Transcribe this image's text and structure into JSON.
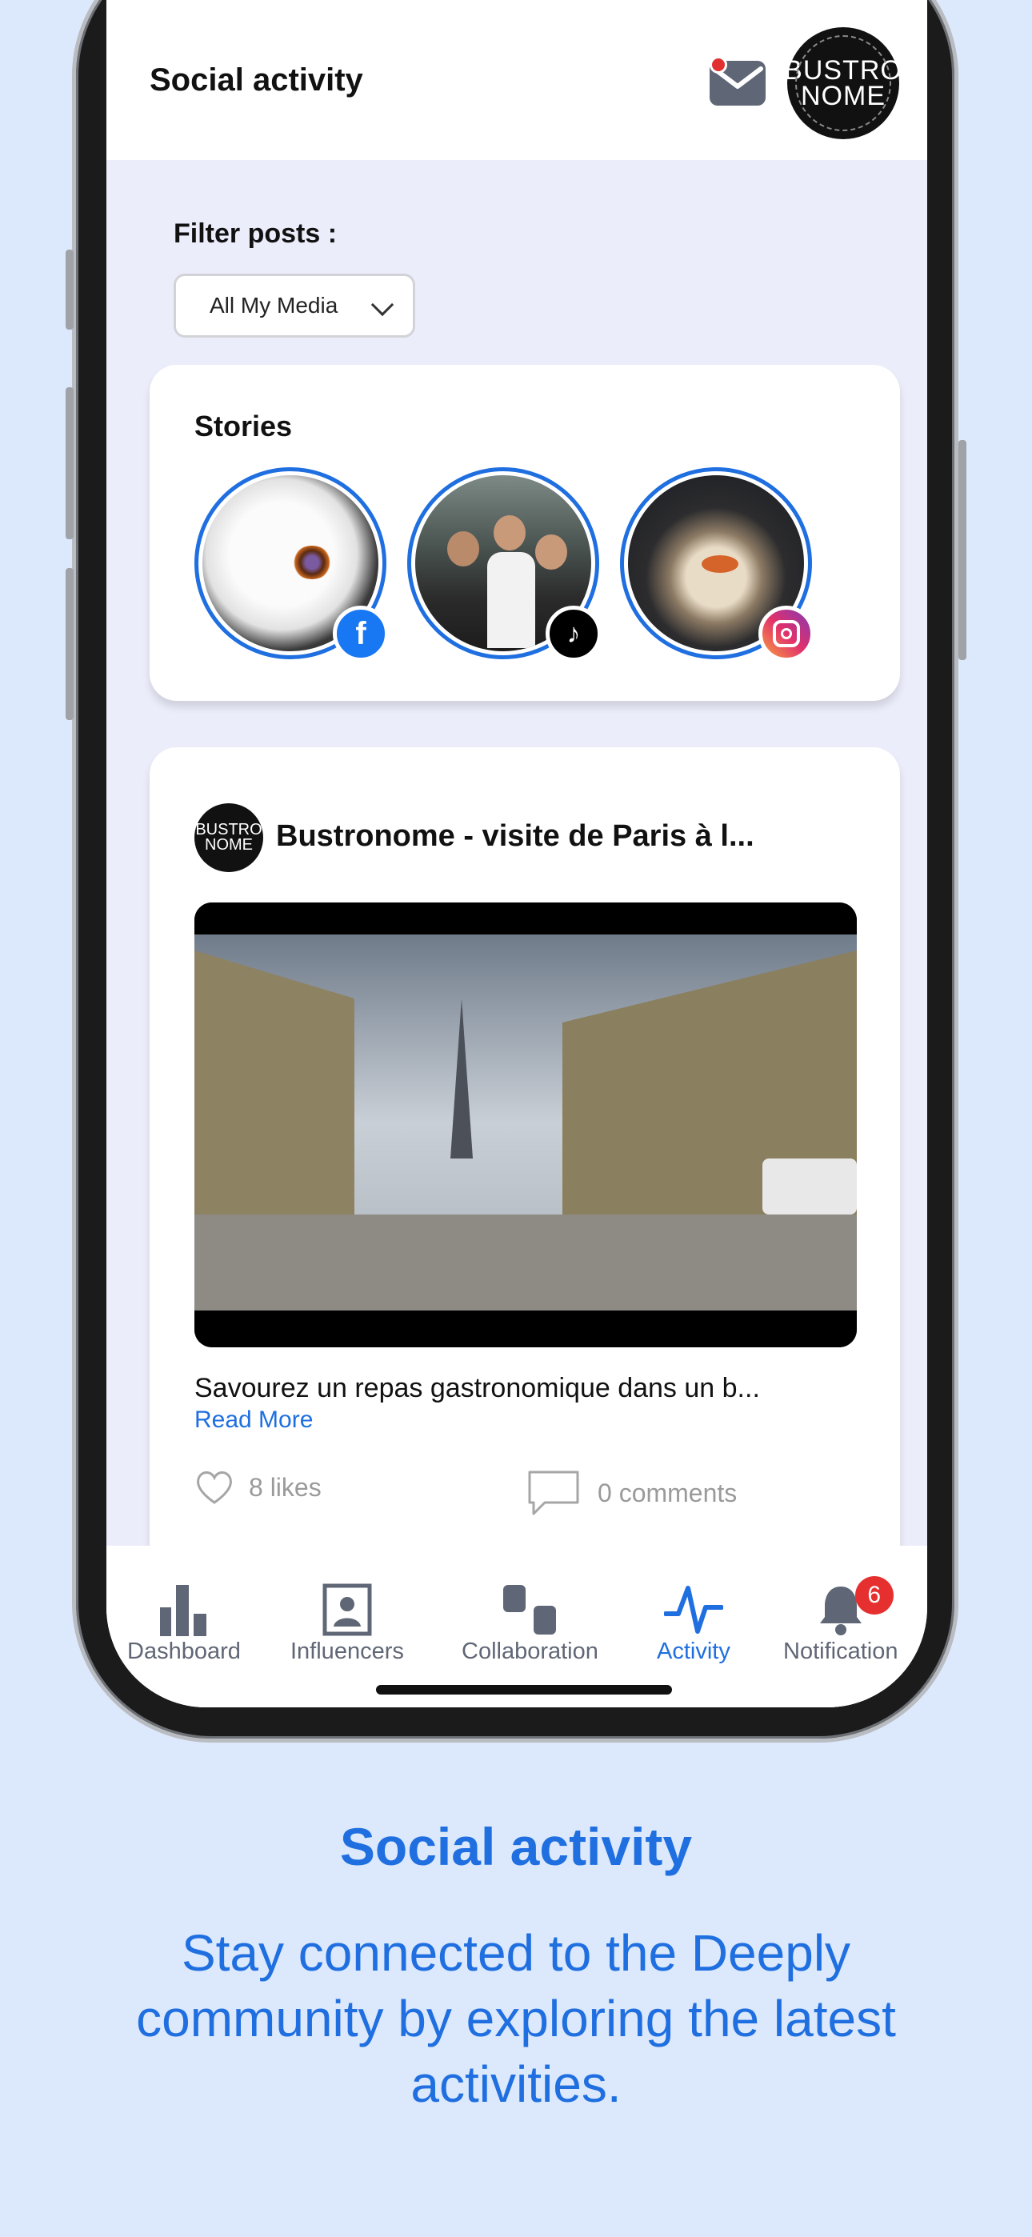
{
  "header": {
    "title": "Social activity",
    "has_unread_mail": true
  },
  "brand": {
    "line1": "BUSTRO",
    "line2": "NOME"
  },
  "filter": {
    "label": "Filter posts :",
    "selected": "All My Media"
  },
  "stories": {
    "title": "Stories",
    "items": [
      {
        "platform": "facebook",
        "badge_icon": "facebook-icon",
        "badge_color": "#1877f2"
      },
      {
        "platform": "tiktok",
        "badge_icon": "tiktok-icon",
        "badge_color": "#000000"
      },
      {
        "platform": "instagram",
        "badge_icon": "instagram-icon",
        "badge_color": "#e1306c"
      }
    ]
  },
  "post": {
    "title": "Bustronome - visite de Paris à l...",
    "caption": "Savourez un repas gastronomique dans un b...",
    "read_more": "Read More",
    "likes": "8 likes",
    "comments": "0 comments"
  },
  "tabs": [
    {
      "label": "Dashboard",
      "icon": "bar-chart-icon",
      "active": false
    },
    {
      "label": "Influencers",
      "icon": "profile-card-icon",
      "active": false
    },
    {
      "label": "Collaboration",
      "icon": "collaboration-icon",
      "active": false
    },
    {
      "label": "Activity",
      "icon": "activity-pulse-icon",
      "active": true
    },
    {
      "label": "Notification",
      "icon": "bell-icon",
      "active": false,
      "badge": "6"
    }
  ],
  "promo": {
    "title": "Social activity",
    "subtitle": "Stay connected to the Deeply community by exploring the latest activities."
  },
  "colors": {
    "accent": "#1f6fe0",
    "background": "#dce8fb",
    "screen_bg": "#ecedfb",
    "badge_red": "#e63030"
  }
}
